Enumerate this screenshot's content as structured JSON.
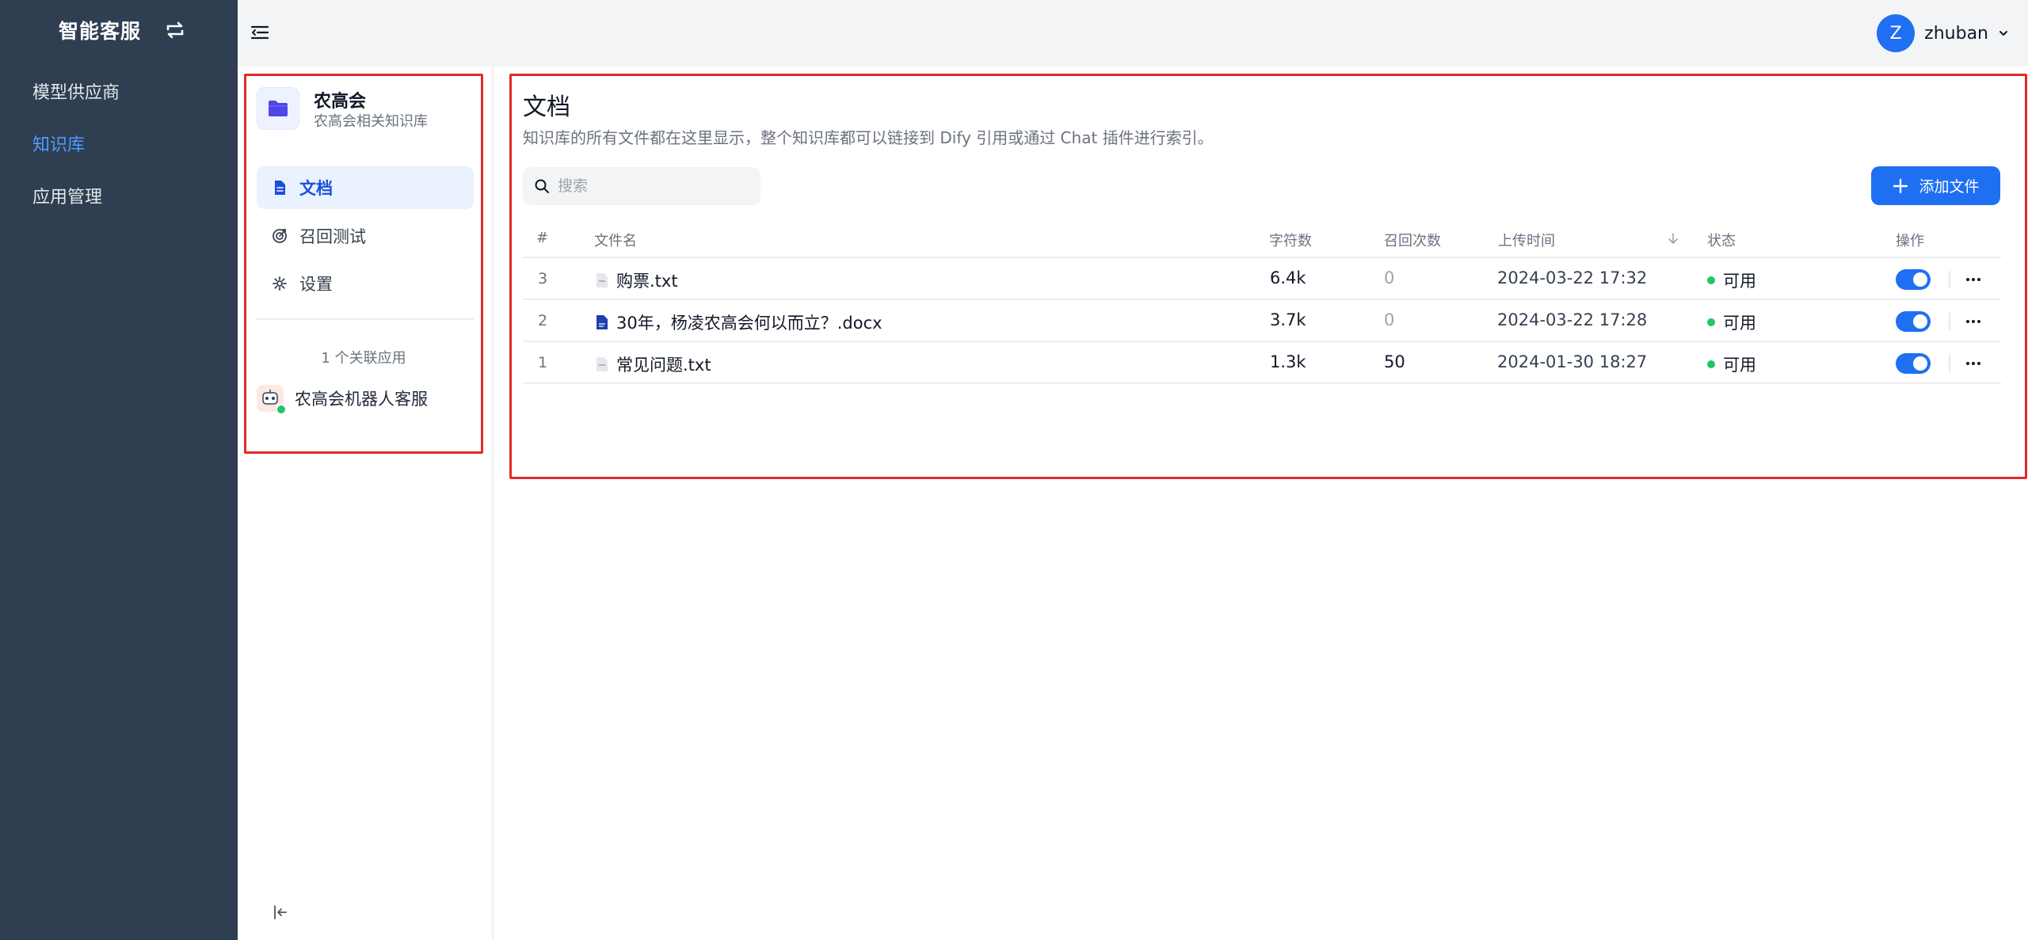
{
  "brand": {
    "title": "智能客服"
  },
  "nav": {
    "items": [
      {
        "label": "模型供应商"
      },
      {
        "label": "知识库"
      },
      {
        "label": "应用管理"
      }
    ]
  },
  "user": {
    "initial": "Z",
    "name": "zhuban"
  },
  "knowledge_base": {
    "name": "农高会",
    "description": "农高会相关知识库",
    "menu": [
      {
        "label": "文档",
        "icon": "document-icon"
      },
      {
        "label": "召回测试",
        "icon": "target-icon"
      },
      {
        "label": "设置",
        "icon": "gear-icon"
      }
    ],
    "linked_apps_label": "1 个关联应用",
    "linked_apps": [
      {
        "name": "农高会机器人客服"
      }
    ]
  },
  "docs": {
    "title": "文档",
    "description": "知识库的所有文件都在这里显示，整个知识库都可以链接到 Dify 引用或通过 Chat 插件进行索引。",
    "search_placeholder": "搜索",
    "add_button": "添加文件",
    "columns": [
      "#",
      "文件名",
      "字符数",
      "召回次数",
      "上传时间",
      "状态",
      "操作"
    ],
    "rows": [
      {
        "index": "3",
        "name": "购票.txt",
        "type": "txt",
        "chars": "6.4k",
        "hits": "0",
        "uploaded": "2024-03-22 17:32",
        "status": "可用",
        "enabled": true
      },
      {
        "index": "2",
        "name": "30年，杨凌农高会何以而立？.docx",
        "type": "docx",
        "chars": "3.7k",
        "hits": "0",
        "uploaded": "2024-03-22 17:28",
        "status": "可用",
        "enabled": true
      },
      {
        "index": "1",
        "name": "常见问题.txt",
        "type": "txt",
        "chars": "1.3k",
        "hits": "50",
        "uploaded": "2024-01-30 18:27",
        "status": "可用",
        "enabled": true
      }
    ]
  },
  "colors": {
    "nav_bg": "#2f3e51",
    "accent": "#1f6ff2",
    "highlight_border": "#e12b2b",
    "status_ok": "#22c55e"
  }
}
